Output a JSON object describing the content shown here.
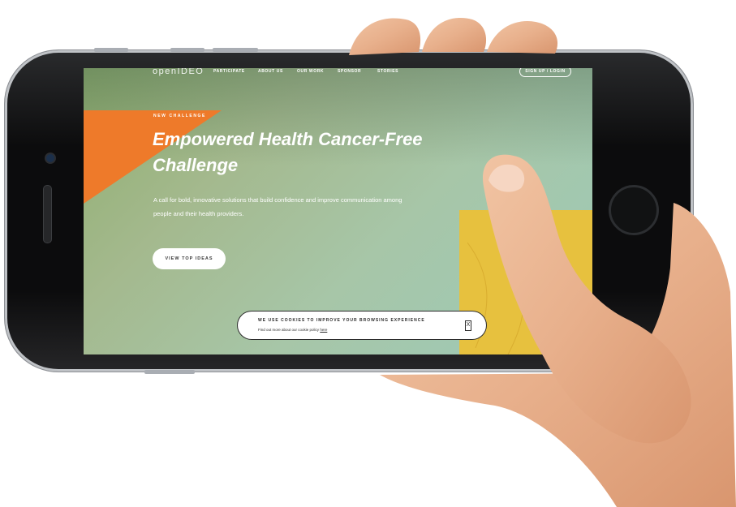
{
  "nav": {
    "logo": "openIDEO",
    "items": [
      "PARTICIPATE",
      "ABOUT US",
      "OUR WORK",
      "SPONSOR",
      "STORIES"
    ],
    "login": "SIGN UP / LOGIN"
  },
  "hero": {
    "badge": "NEW CHALLENGE",
    "title": "Empowered Health Cancer-Free Challenge",
    "description": "A call for bold, innovative solutions that build confidence and improve communication among people and their health providers.",
    "cta": "VIEW TOP IDEAS"
  },
  "cookie": {
    "headline": "WE USE COOKIES TO IMPROVE YOUR BROWSING EXPERIENCE",
    "sub_text": "Find out more about our cookie policy",
    "link": "here",
    "close": "X"
  },
  "colors": {
    "orange": "#ee7a2a",
    "yellow": "#e7c13e",
    "green": "#a7c6a8"
  }
}
